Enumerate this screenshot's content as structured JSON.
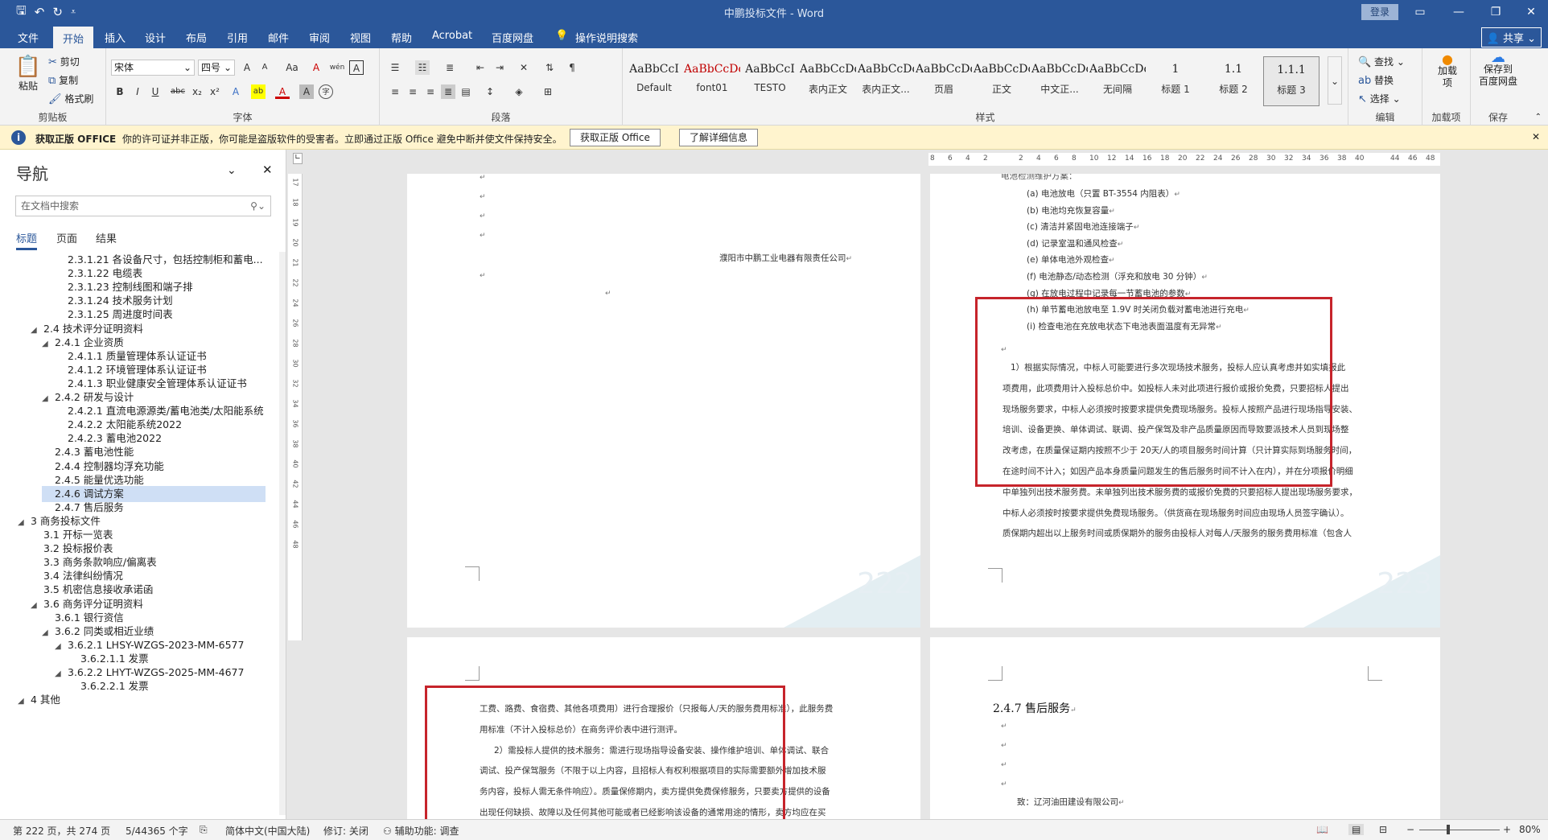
{
  "app": {
    "title": "中鹏投标文件 - Word",
    "login": "登录"
  },
  "qat": {
    "save": "🖫",
    "undo": "↶",
    "redo": "↻",
    "customize": "⩡"
  },
  "tabs": [
    "文件",
    "开始",
    "插入",
    "设计",
    "布局",
    "引用",
    "邮件",
    "审阅",
    "视图",
    "帮助",
    "Acrobat",
    "百度网盘",
    "操作说明搜索"
  ],
  "share": "共享",
  "ribbon": {
    "clipboard": {
      "paste": "粘贴",
      "cut": "剪切",
      "copy": "复制",
      "painter": "格式刷",
      "label": "剪贴板"
    },
    "font": {
      "name": "宋体",
      "size": "四号",
      "label": "字体",
      "grow": "A",
      "shrink": "A",
      "case": "Aa",
      "clear": "A",
      "pinyin": "wén",
      "border_char": "A",
      "bold": "B",
      "italic": "I",
      "underline": "U",
      "strike": "abc",
      "sub": "x₂",
      "sup": "x²",
      "effects": "A",
      "highlight": "ab",
      "color": "A",
      "shade": "A",
      "enclose": "字"
    },
    "paragraph": {
      "label": "段落"
    },
    "styles": {
      "label": "样式",
      "items": [
        {
          "sample": "AaBbCcI",
          "name": "Default"
        },
        {
          "sample": "AaBbCcDc",
          "name": "font01"
        },
        {
          "sample": "AaBbCcI",
          "name": "TESTO"
        },
        {
          "sample": "AaBbCcDdI",
          "name": "表内正文"
        },
        {
          "sample": "AaBbCcDdI",
          "name": "表内正文..."
        },
        {
          "sample": "AaBbCcDdE",
          "name": "页眉"
        },
        {
          "sample": "AaBbCcDc",
          "name": "正文"
        },
        {
          "sample": "AaBbCcDc",
          "name": "中文正..."
        },
        {
          "sample": "AaBbCcDc",
          "name": "无间隔"
        },
        {
          "sample": "1",
          "name": "标题 1"
        },
        {
          "sample": "1.1",
          "name": "标题 2"
        },
        {
          "sample": "1.1.1",
          "name": "标题 3"
        }
      ]
    },
    "editing": {
      "find": "查找",
      "replace": "替换",
      "select": "选择",
      "label": "编辑"
    },
    "addin": {
      "btn": "加载项",
      "label": "加载项"
    },
    "save": {
      "btn1": "保存到",
      "btn2": "百度网盘",
      "label": "保存"
    }
  },
  "infobar": {
    "title": "获取正版 OFFICE",
    "message": "你的许可证并非正版，你可能是盗版软件的受害者。立即通过正版 Office 避免中断并使文件保持安全。",
    "btn1": "获取正版 Office",
    "btn2": "了解详细信息",
    "close": "✕"
  },
  "nav": {
    "title": "导航",
    "search_placeholder": "在文档中搜索",
    "tabs": [
      "标题",
      "页面",
      "结果"
    ],
    "items": [
      {
        "text": "2.3.1.21 各设备尺寸，包括控制柜和蓄电...",
        "level": 4,
        "tri": ""
      },
      {
        "text": "2.3.1.22 电缆表",
        "level": 4,
        "tri": ""
      },
      {
        "text": "2.3.1.23 控制线图和端子排",
        "level": 4,
        "tri": ""
      },
      {
        "text": "2.3.1.24 技术服务计划",
        "level": 4,
        "tri": ""
      },
      {
        "text": "2.3.1.25 周进度时间表",
        "level": 4,
        "tri": ""
      },
      {
        "text": "2.4 技术评分证明资料",
        "level": 2,
        "tri": "◢"
      },
      {
        "text": "2.4.1 企业资质",
        "level": 3,
        "tri": "◢"
      },
      {
        "text": "2.4.1.1 质量管理体系认证证书",
        "level": 4,
        "tri": ""
      },
      {
        "text": "2.4.1.2 环境管理体系认证证书",
        "level": 4,
        "tri": ""
      },
      {
        "text": "2.4.1.3 职业健康安全管理体系认证证书",
        "level": 4,
        "tri": ""
      },
      {
        "text": "2.4.2 研发与设计",
        "level": 3,
        "tri": "◢"
      },
      {
        "text": "2.4.2.1 直流电源源类/蓄电池类/太阳能系统",
        "level": 4,
        "tri": ""
      },
      {
        "text": "2.4.2.2 太阳能系统2022",
        "level": 4,
        "tri": ""
      },
      {
        "text": "2.4.2.3 蓄电池2022",
        "level": 4,
        "tri": ""
      },
      {
        "text": "2.4.3 蓄电池性能",
        "level": 3,
        "tri": ""
      },
      {
        "text": "2.4.4 控制器均浮充功能",
        "level": 3,
        "tri": ""
      },
      {
        "text": "2.4.5 能量优选功能",
        "level": 3,
        "tri": ""
      },
      {
        "text": "2.4.6 调试方案",
        "level": 3,
        "tri": "",
        "selected": true
      },
      {
        "text": "2.4.7 售后服务",
        "level": 3,
        "tri": ""
      },
      {
        "text": "3 商务投标文件",
        "level": 1,
        "tri": "◢"
      },
      {
        "text": "3.1 开标一览表",
        "level": 2,
        "tri": ""
      },
      {
        "text": "3.2 投标报价表",
        "level": 2,
        "tri": ""
      },
      {
        "text": "3.3 商务条款响应/偏离表",
        "level": 2,
        "tri": ""
      },
      {
        "text": "3.4 法律纠纷情况",
        "level": 2,
        "tri": ""
      },
      {
        "text": "3.5 机密信息接收承诺函",
        "level": 2,
        "tri": ""
      },
      {
        "text": "3.6 商务评分证明资料",
        "level": 2,
        "tri": "◢"
      },
      {
        "text": "3.6.1 银行资信",
        "level": 3,
        "tri": ""
      },
      {
        "text": "3.6.2 同类或相近业绩",
        "level": 3,
        "tri": "◢"
      },
      {
        "text": "3.6.2.1 LHSY-WZGS-2023-MM-6577",
        "level": 4,
        "tri": "◢"
      },
      {
        "text": "3.6.2.1.1 发票",
        "level": 5,
        "tri": ""
      },
      {
        "text": "3.6.2.2 LHYT-WZGS-2025-MM-4677",
        "level": 4,
        "tri": "◢"
      },
      {
        "text": "3.6.2.2.1 发票",
        "level": 5,
        "tri": ""
      },
      {
        "text": "4 其他",
        "level": 1,
        "tri": "◢"
      }
    ]
  },
  "ruler": {
    "vertical": [
      "17",
      "18",
      "19",
      "20",
      "21",
      "22",
      "24",
      "26",
      "28",
      "30",
      "32",
      "34",
      "36",
      "38",
      "40",
      "42",
      "44",
      "46",
      "48"
    ],
    "horizontal": [
      "8",
      "6",
      "4",
      "2",
      "",
      "2",
      "4",
      "6",
      "8",
      "10",
      "12",
      "14",
      "16",
      "18",
      "20",
      "22",
      "24",
      "26",
      "28",
      "30",
      "32",
      "34",
      "36",
      "38",
      "40",
      "",
      "44",
      "46",
      "48"
    ]
  },
  "pages": {
    "p222": {
      "company": "濮阳市中鹏工业电器有限责任公司",
      "number": "222"
    },
    "p223": {
      "number": "223",
      "head": "电池检测维护方案：",
      "list": [
        "(a) 电池放电（只置 BT-3554 内阻表）",
        "(b) 电池均充恢复容量",
        "(c) 清洁并紧固电池连接端子",
        "(d) 记录室温和通风检查",
        "(e) 单体电池外观检查",
        "(f) 电池静态/动态检测（浮充和放电 30 分钟）",
        "(g) 在放电过程中记录每一节蓄电池的参数",
        "(h) 单节蓄电池放电至 1.9V 时关闭负载对蓄电池进行充电",
        "(i) 检查电池在充放电状态下电池表面温度有无异常"
      ],
      "boxed_lines": [
        "1）根据实际情况，中标人可能要进行多次现场技术服务，投标人应认真考虑并如实填报此",
        "项费用，此项费用计入投标总价中。如投标人未对此项进行报价或报价免费，只要招标人提出",
        "现场服务要求，中标人必须按时按要求提供免费现场服务。投标人按照产品进行现场指导安装、",
        "培训、设备更换、单体调试、联调、投产保驾及非产品质量原因而导致要派技术人员到现场整",
        "改考虑，在质量保证期内按照不少于 20天/人的项目服务时间计算（只计算实际到场服务时间，",
        "在途时间不计入；如因产品本身质量问题发生的售后服务时间不计入在内），并在分项报价明细",
        "中单独列出技术服务费。未单独列出技术服务费的或报价免费的只要招标人提出现场服务要求，",
        "中标人必须按时按要求提供免费现场服务。（供货商在现场服务时间应由现场人员签字确认）。",
        "质保期内超出以上服务时间或质保期外的服务由投标人对每人/天服务的服务费用标准（包含人"
      ]
    },
    "p224": {
      "lines": [
        "工费、路费、食宿费、其他各项费用）进行合理报价（只报每人/天的服务费用标准），此服务费",
        "用标准（不计入投标总价）在商务评价表中进行测评。",
        "2）需投标人提供的技术服务：需进行现场指导设备安装、操作维护培训、单体调试、联合",
        "调试、投产保驾服务（不限于以上内容，且招标人有权利根据项目的实际需要额外增加技术服",
        "务内容，投标人需无条件响应）。质量保修期内，卖方提供免费保修服务，只要卖方提供的设备",
        "出现任何缺损、故障以及任何其他可能或者已经影响该设备的通常用途的情形，卖方均应在买"
      ]
    },
    "p225": {
      "heading": "2.4.7  售后服务",
      "to": "致：辽河油田建设有限公司"
    }
  },
  "status": {
    "page": "第 222 页，共 274 页",
    "words": "5/44365 个字",
    "lang": "简体中文(中国大陆)",
    "track": "修订: 关闭",
    "access": "辅助功能: 调查",
    "zoom": "80%"
  },
  "colors": {
    "brand": "#2b579a",
    "highlight_box": "#c6242b",
    "infobar": "#fff4ce"
  }
}
